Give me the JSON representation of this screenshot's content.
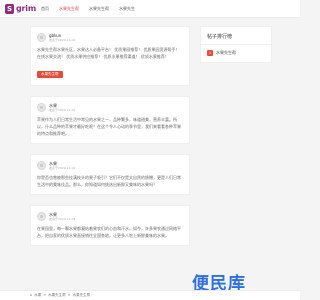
{
  "header": {
    "logo_letter": "S",
    "logo_text": "grim",
    "nav": [
      "首页",
      "水果先生帮",
      "水果先生帮",
      "水果先生"
    ]
  },
  "posts": [
    {
      "name": "gbkun",
      "time": "发表于2024-11-01",
      "text": "水果先生帮水果社区，水果达人必备平台！ 优质果园推荐！ 优质果园资源帮手！ 在线水果交流！ 优质水果供应推荐！ 优质水果推荐渠道！ 优质水果推荐！",
      "tag": "水果先生帮"
    },
    {
      "name": "水果",
      "time": "发表于2024-11-01",
      "text": "苹果作为人们日常生活中常见的水果之一，品种繁多，味道甜美，营养丰富。所以，什么品种的苹果才最好吃呢？在这个令人心动的季节里，我们来看看各种苹果的特点和推荐吧。"
    },
    {
      "name": "水果",
      "time": "发表于2024-11-01",
      "text": "你是否也曾被那些挂满枝头的果子吸引？它们不仅是大自然的馈赠，更是人们日常生活中的美味佳品。那么，你知道如何挑选出新鲜又美味的水果吗？"
    },
    {
      "name": "水果",
      "time": "发表于2024-11-01",
      "text": "在果园里，每一颗水果都凝结着果农们的心血和汗水。如今，许多果农通过网络平台，把自家的优质水果直接销往全国各地，让更多人吃上新鲜美味的水果。"
    }
  ],
  "sidebar": {
    "title": "帖子排行榜",
    "ranks": [
      {
        "num": "1",
        "label": "水果先生帮"
      }
    ]
  },
  "footer": {
    "crumbs": [
      "水果",
      "水果先生帮",
      "水果先生帮"
    ],
    "separator": ">"
  },
  "watermark": "便民库",
  "colors": {
    "accent": "#e64a3b",
    "brand": "#8e2b7e",
    "watermark": "#2f6fe5"
  }
}
